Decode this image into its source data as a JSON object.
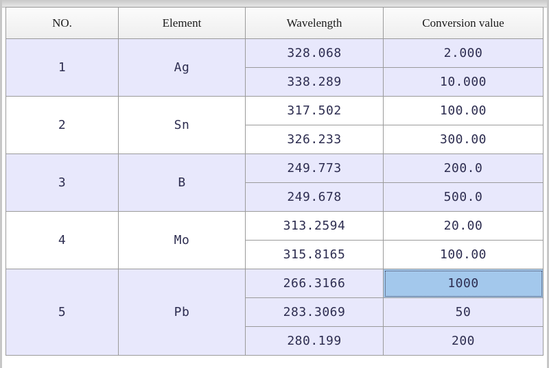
{
  "table": {
    "headers": {
      "no": "NO.",
      "element": "Element",
      "wavelength": "Wavelength",
      "conversion": "Conversion value"
    },
    "groups": [
      {
        "no": "1",
        "element": "Ag",
        "shade": "alt",
        "lines": [
          {
            "wavelength": "328.068",
            "conversion": "2.000"
          },
          {
            "wavelength": "338.289",
            "conversion": "10.000"
          }
        ]
      },
      {
        "no": "2",
        "element": "Sn",
        "shade": "plain",
        "lines": [
          {
            "wavelength": "317.502",
            "conversion": "100.00"
          },
          {
            "wavelength": "326.233",
            "conversion": "300.00"
          }
        ]
      },
      {
        "no": "3",
        "element": "B",
        "shade": "alt",
        "lines": [
          {
            "wavelength": "249.773",
            "conversion": "200.0"
          },
          {
            "wavelength": "249.678",
            "conversion": "500.0"
          }
        ]
      },
      {
        "no": "4",
        "element": "Mo",
        "shade": "plain",
        "lines": [
          {
            "wavelength": "313.2594",
            "conversion": "20.00"
          },
          {
            "wavelength": "315.8165",
            "conversion": "100.00"
          }
        ]
      },
      {
        "no": "5",
        "element": "Pb",
        "shade": "alt",
        "lines": [
          {
            "wavelength": "266.3166",
            "conversion": "1000",
            "selected": true
          },
          {
            "wavelength": "283.3069",
            "conversion": "50"
          },
          {
            "wavelength": "280.199",
            "conversion": "200"
          }
        ]
      }
    ]
  },
  "colors": {
    "alt_row": "#e8e8fc",
    "plain_row": "#ffffff",
    "selected_cell": "#a3c8ec",
    "grid_line": "#9a9a9a",
    "cell_text": "#2d2d50"
  }
}
